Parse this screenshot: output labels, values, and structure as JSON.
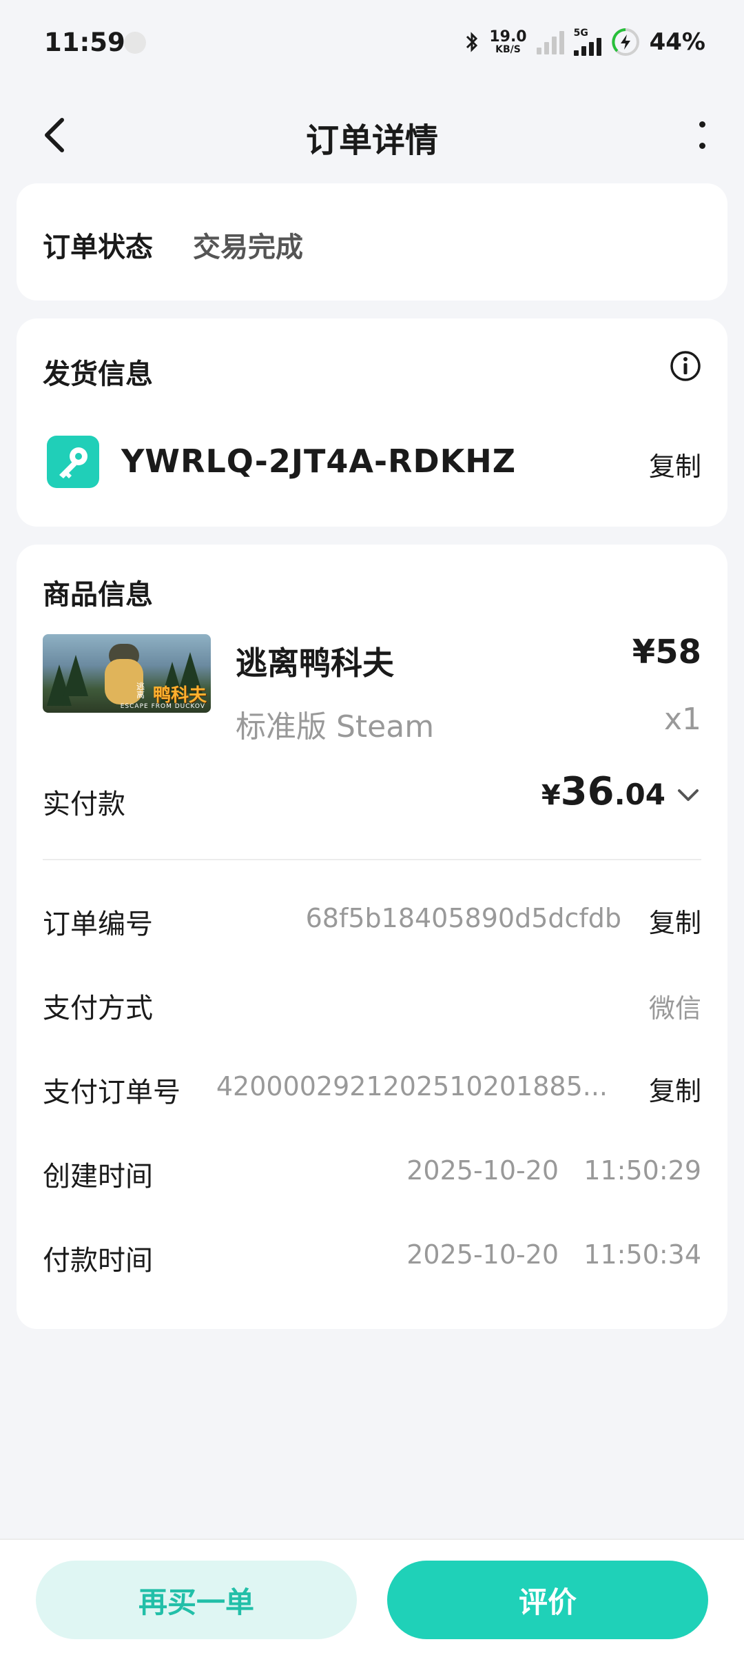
{
  "status_bar": {
    "time": "11:59",
    "net_speed": "19.0",
    "net_unit": "KB/S",
    "network_type": "5G",
    "battery": "44%"
  },
  "header": {
    "title": "订单详情"
  },
  "order_status": {
    "label": "订单状态",
    "value": "交易完成"
  },
  "shipping": {
    "title": "发货信息",
    "code": "YWRLQ-2JT4A-RDKHZ",
    "copy_label": "复制"
  },
  "goods": {
    "title": "商品信息",
    "thumbnail_text": "鸭科夫",
    "thumbnail_small": "逃离",
    "thumbnail_tagline": "ESCAPE FROM DUCKOV",
    "name": "逃离鸭科夫",
    "price": "¥58",
    "edition": "标准版 Steam",
    "quantity": "x1",
    "paid_label": "实付款",
    "paid_symbol": "¥",
    "paid_integer": "36",
    "paid_decimal": ".04"
  },
  "details": [
    {
      "label": "订单编号",
      "value": "68f5b18405890d5dcfdb",
      "action": "复制"
    },
    {
      "label": "支付方式",
      "value": "微信",
      "action": ""
    },
    {
      "label": "支付订单号",
      "value": "42000029212025102018​85...",
      "action": "复制"
    },
    {
      "label": "创建时间",
      "value": "2025-10-20   11:50:29",
      "action": ""
    },
    {
      "label": "付款时间",
      "value": "2025-10-20   11:50:34",
      "action": ""
    }
  ],
  "actions": {
    "rebuy": "再买一单",
    "review": "评价"
  },
  "colors": {
    "accent": "#1fd1b8",
    "accent_light": "#dff6f3",
    "background": "#f4f5f8"
  }
}
